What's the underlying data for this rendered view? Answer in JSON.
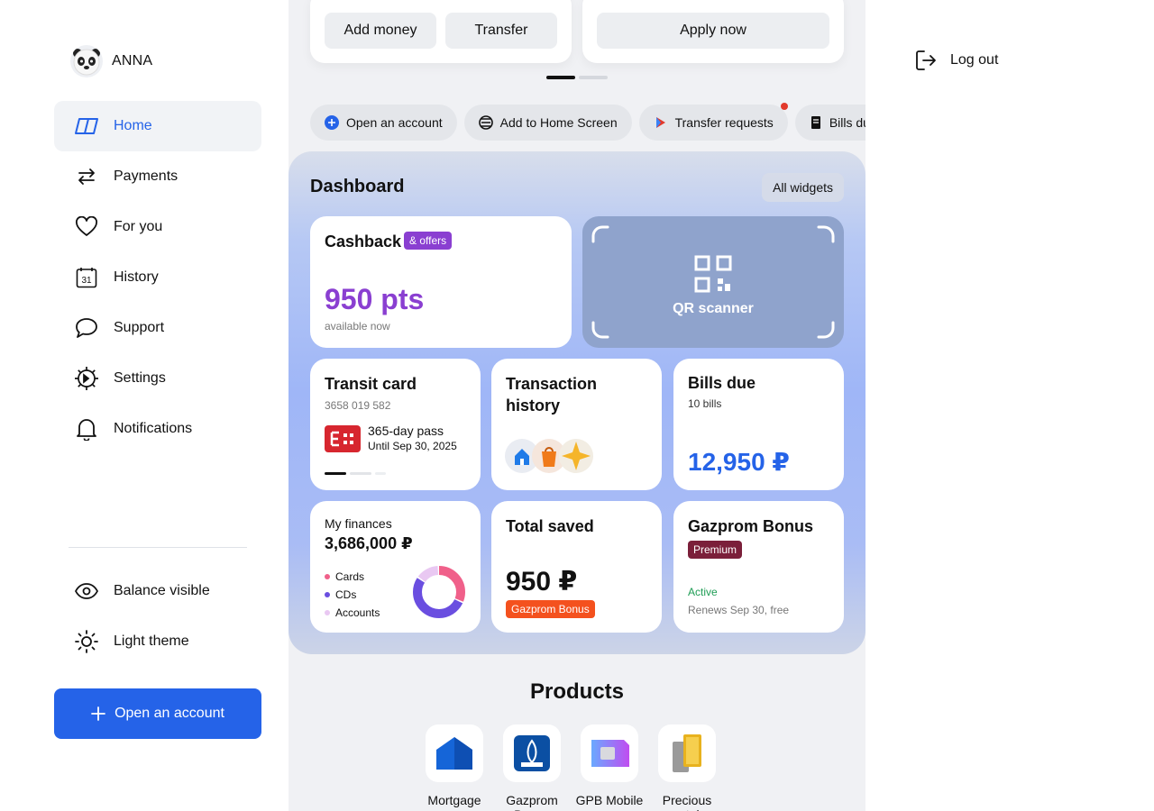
{
  "user": {
    "name": "ANNA"
  },
  "nav": [
    {
      "label": "Home",
      "icon": "home-icon",
      "active": true
    },
    {
      "label": "Payments",
      "icon": "transfer-arrows-icon"
    },
    {
      "label": "For you",
      "icon": "heart-icon"
    },
    {
      "label": "History",
      "icon": "calendar-icon",
      "badge": "31"
    },
    {
      "label": "Support",
      "icon": "chat-bubble-icon"
    },
    {
      "label": "Settings",
      "icon": "gear-icon"
    },
    {
      "label": "Notifications",
      "icon": "bell-icon"
    }
  ],
  "toggles": [
    {
      "label": "Balance visible",
      "icon": "eye-icon"
    },
    {
      "label": "Light theme",
      "icon": "sun-icon"
    }
  ],
  "sidebar_cta": "Open an account",
  "top_cards": {
    "add_money": "Add money",
    "transfer": "Transfer",
    "apply_now": "Apply now"
  },
  "chips": [
    {
      "label": "Open an account",
      "icon": "plus-circle-icon"
    },
    {
      "label": "Add to Home Screen",
      "icon": "layers-icon"
    },
    {
      "label": "Transfer requests",
      "icon": "request-icon",
      "dot": true
    },
    {
      "label": "Bills due",
      "icon": "bill-icon"
    }
  ],
  "dashboard": {
    "title": "Dashboard",
    "all_widgets": "All widgets",
    "cashback": {
      "title": "Cashback",
      "tag": "& offers",
      "value": "950 pts",
      "sub": "available now"
    },
    "qr": {
      "label": "QR scanner"
    },
    "transit": {
      "title": "Transit card",
      "number": "3658 019 582",
      "pass": "365-day pass",
      "until": "Until Sep 30, 2025"
    },
    "transactions": {
      "title_line1": "Transaction",
      "title_line2": "history"
    },
    "bills": {
      "title": "Bills due",
      "count": "10 bills",
      "amount": "12,950 ₽"
    },
    "finances": {
      "title": "My finances",
      "amount": "3,686,000 ₽",
      "legend": [
        {
          "label": "Cards",
          "color": "#f0608a",
          "share": 0.32
        },
        {
          "label": "CDs",
          "color": "#6a4ee0",
          "share": 0.53
        },
        {
          "label": "Accounts",
          "color": "#e9c8f2",
          "share": 0.15
        }
      ]
    },
    "saved": {
      "title": "Total saved",
      "amount": "950 ₽",
      "tag": "Gazprom Bonus"
    },
    "gazprom": {
      "title": "Gazprom Bonus",
      "tag": "Premium",
      "status": "Active",
      "renew": "Renews Sep 30, free"
    }
  },
  "products": {
    "title": "Products",
    "items": [
      {
        "label": "Mortgage",
        "icon": "house-icon"
      },
      {
        "label": "Gazprom Bonus",
        "icon": "gazprom-logo-icon"
      },
      {
        "label": "GPB Mobile",
        "icon": "sim-card-icon"
      },
      {
        "label": "Precious metals",
        "icon": "gold-bar-icon"
      }
    ]
  },
  "logout": "Log out",
  "colors": {
    "accent": "#2563e8",
    "purple": "#8a3fd1",
    "gazprom_orange": "#f4511e",
    "premium": "#7b1f3a"
  }
}
